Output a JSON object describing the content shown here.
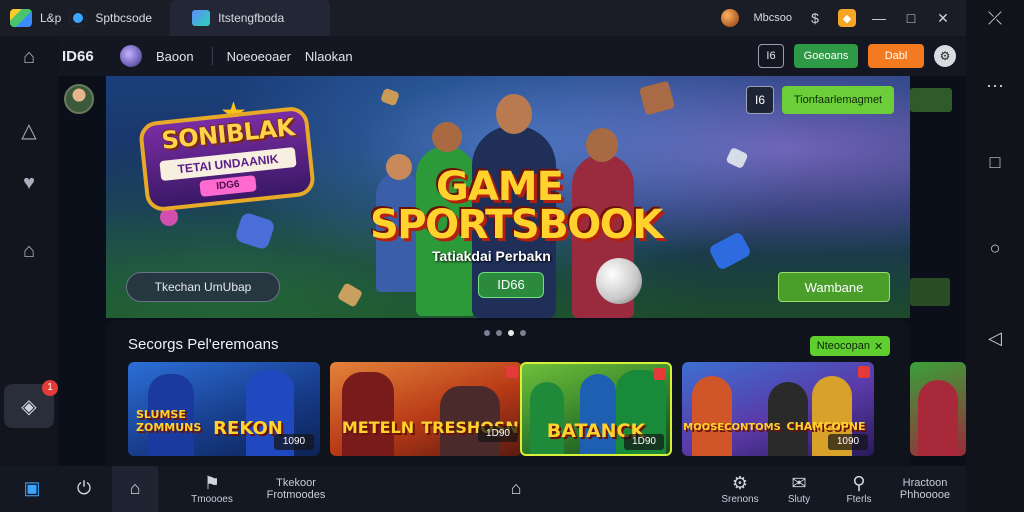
{
  "titlebar": {
    "app_name_1": "L&p",
    "app_name_2": "Sptbcsode",
    "tab_label": "Itstengfboda",
    "coin_label": "Mbcsoo",
    "icons": [
      "stack-icon",
      "blue-dot-icon",
      "tab-app-icon",
      "coin-icon",
      "dollar-icon",
      "gift-icon",
      "minimize-icon",
      "restore-icon",
      "close-icon"
    ]
  },
  "topnav": {
    "brand": "ID66",
    "links": [
      "Baoon",
      "Noeoeoaer",
      "Nlaokan"
    ],
    "label_box": "I6",
    "btn_green": "Goeoans",
    "btn_orange": "Dabl"
  },
  "hero": {
    "badge_title": "SONIBLAK",
    "badge_sub": "TETAI UNDAANIK",
    "badge_tag": "IDG6",
    "title_line1": "GAME",
    "title_line2": "SPORTSBOOK",
    "tagline": "Tatiakdai Perbakn",
    "pill": "ID66",
    "search_btn": "Tkechan UmUbap",
    "cta": "Wambane",
    "top_label": "I6",
    "top_btn": "Tionfaarlemagmet"
  },
  "section": {
    "title": "Secorgs Pel'eremoans",
    "pill": "Nteocopan"
  },
  "cards": [
    {
      "title_top": "SLUMSE ZOMMUNS",
      "title": "REKON",
      "tag": "1090"
    },
    {
      "title_top": "METELN",
      "title": "TRESHOSN",
      "tag": "1D90"
    },
    {
      "title_top": "",
      "title": "BATANCK",
      "tag": "1D90"
    },
    {
      "title_top": "MOOSECONTOMS",
      "title": "CHAMCOPNE",
      "tag": "1090"
    }
  ],
  "bottombar": {
    "items": [
      "",
      "",
      "",
      "Tmoooes",
      "Tkekoor Frotmoodes",
      "",
      "Srenons",
      "Sluty",
      "Fterls",
      "Hractoon Phhooooe"
    ]
  },
  "colors": {
    "accent_green": "#2f9a45",
    "accent_orange": "#f47a20",
    "accent_lime": "#5ecf2f",
    "title_gold": "#ffd22e"
  }
}
